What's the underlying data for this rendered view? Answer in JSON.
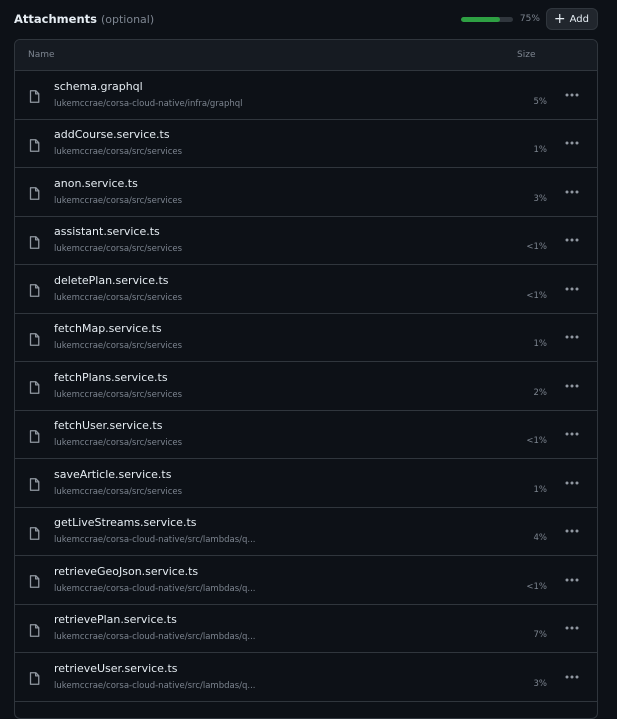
{
  "header": {
    "title": "Attachments",
    "optional": "(optional)",
    "progress_percent": 75,
    "progress_label": "75%",
    "add_label": "Add"
  },
  "table": {
    "col_name": "Name",
    "col_size": "Size",
    "rows": [
      {
        "name": "schema.graphql",
        "path": "lukemccrae/corsa-cloud-native/infra/graphql",
        "size": "5%"
      },
      {
        "name": "addCourse.service.ts",
        "path": "lukemccrae/corsa/src/services",
        "size": "1%"
      },
      {
        "name": "anon.service.ts",
        "path": "lukemccrae/corsa/src/services",
        "size": "3%"
      },
      {
        "name": "assistant.service.ts",
        "path": "lukemccrae/corsa/src/services",
        "size": "<1%"
      },
      {
        "name": "deletePlan.service.ts",
        "path": "lukemccrae/corsa/src/services",
        "size": "<1%"
      },
      {
        "name": "fetchMap.service.ts",
        "path": "lukemccrae/corsa/src/services",
        "size": "1%"
      },
      {
        "name": "fetchPlans.service.ts",
        "path": "lukemccrae/corsa/src/services",
        "size": "2%"
      },
      {
        "name": "fetchUser.service.ts",
        "path": "lukemccrae/corsa/src/services",
        "size": "<1%"
      },
      {
        "name": "saveArticle.service.ts",
        "path": "lukemccrae/corsa/src/services",
        "size": "1%"
      },
      {
        "name": "getLiveStreams.service.ts",
        "path": "lukemccrae/corsa-cloud-native/src/lambdas/q...",
        "size": "4%"
      },
      {
        "name": "retrieveGeoJson.service.ts",
        "path": "lukemccrae/corsa-cloud-native/src/lambdas/q...",
        "size": "<1%"
      },
      {
        "name": "retrievePlan.service.ts",
        "path": "lukemccrae/corsa-cloud-native/src/lambdas/q...",
        "size": "7%"
      },
      {
        "name": "retrieveUser.service.ts",
        "path": "lukemccrae/corsa-cloud-native/src/lambdas/q...",
        "size": "3%"
      },
      {
        "name": "",
        "path": "",
        "size": ""
      }
    ]
  },
  "icons": {
    "file": "file-icon",
    "more": "kebab-horizontal-icon",
    "add": "plus-icon"
  },
  "colors": {
    "background": "#0d1117",
    "progress": "#2ea043",
    "border": "#30363d"
  }
}
